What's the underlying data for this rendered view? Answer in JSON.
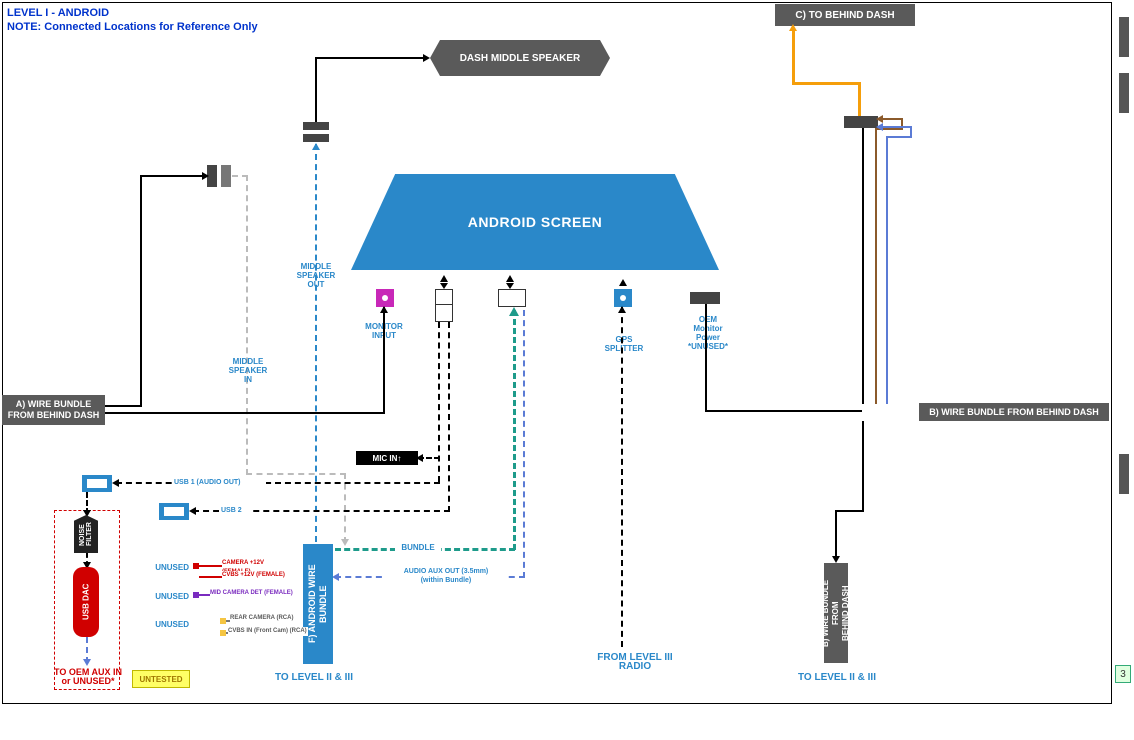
{
  "header": {
    "line1": "LEVEL I - ANDROID",
    "line2": "NOTE: Connected Locations for Reference Only"
  },
  "box_c": "C) TO BEHIND DASH",
  "dash_speaker": "DASH MIDDLE SPEAKER",
  "android": "ANDROID SCREEN",
  "bar_a_l1": "A) WIRE BUNDLE",
  "bar_a_l2": "FROM BEHIND DASH",
  "bar_b": "B) WIRE BUNDLE FROM BEHIND DASH",
  "labels": {
    "middle_speaker_out": "MIDDLE\nSPEAKER\nOUT",
    "middle_speaker_in": "MIDDLE\nSPEAKER\nIN",
    "monitor_input": "MONITOR INPUT",
    "gps_splitter": "GPS\nSPLITTER",
    "oem_monitor_power": "OEM\nMonitor\nPower\n*UNUSED*",
    "mic_in": "MIC IN↑",
    "usb1": "USB 1 (AUDIO OUT)",
    "usb2": "USB 2",
    "bundle": "BUNDLE",
    "audio_aux": "AUDIO AUX OUT (3.5mm)\n(within Bundle)",
    "to_level_left": "TO LEVEL II & III",
    "to_level_right": "TO LEVEL II & III",
    "from_level3": "FROM LEVEL III\nRADIO",
    "noise_filter": "NOISE\nFILTER",
    "usb_dac": "USB DAC",
    "to_oem_aux": "TO OEM AUX IN\nor UNUSED*",
    "untested": "UNTESTED",
    "unused": "UNUSED",
    "cam12v_f": "CAMERA +12V (FEMALE)",
    "cvbs12v_f": "CVBS +12V (FEMALE)",
    "midcam_det": "MID CAMERA DET (FEMALE)",
    "rearcam_rca": "REAR CAMERA (RCA)",
    "cvbs_in_rca": "CVBS IN (Front Cam) (RCA)"
  },
  "fbundle": "F) ANDROID WIRE\nBUNDLE",
  "bundle_b_vert": "B) WIRE BUNDLE\nFROM\nBEHIND DASH"
}
